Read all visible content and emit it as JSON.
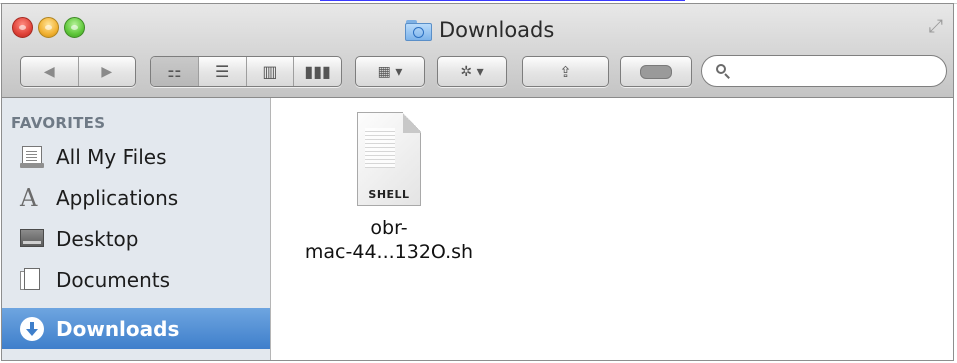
{
  "window": {
    "title": "Downloads",
    "icons": {
      "close": "close-traffic-light",
      "minimize": "minimize-traffic-light",
      "zoom": "zoom-traffic-light",
      "title_folder": "downloads-folder-icon",
      "fullscreen": "fullscreen-arrows-icon"
    }
  },
  "toolbar": {
    "back": "◀",
    "forward": "▶",
    "views": [
      "icon-view",
      "list-view",
      "column-view",
      "coverflow-view"
    ],
    "view_glyphs": [
      "⚏",
      "☰",
      "▥",
      "▮▮▮"
    ],
    "arrange_glyph": "▦ ▾",
    "action_glyph": "✲ ▾",
    "share_glyph": "⇪",
    "search": {
      "value": "",
      "placeholder": ""
    }
  },
  "sidebar": {
    "heading": "FAVORITES",
    "items": [
      {
        "label": "All My Files",
        "icon": "all-my-files-icon",
        "selected": false
      },
      {
        "label": "Applications",
        "icon": "applications-icon",
        "selected": false
      },
      {
        "label": "Desktop",
        "icon": "desktop-icon",
        "selected": false
      },
      {
        "label": "Documents",
        "icon": "documents-icon",
        "selected": false
      },
      {
        "label": "Downloads",
        "icon": "downloads-icon",
        "selected": true
      }
    ]
  },
  "files": [
    {
      "badge": "SHELL",
      "name_line1": "obr-",
      "name_line2": "mac-44...132O.sh",
      "icon": "shell-script-file-icon"
    }
  ],
  "colors": {
    "selection": "#3f7fcb",
    "sidebar_bg": "#e3e8ee",
    "sidebar_heading": "#6f7a86"
  }
}
